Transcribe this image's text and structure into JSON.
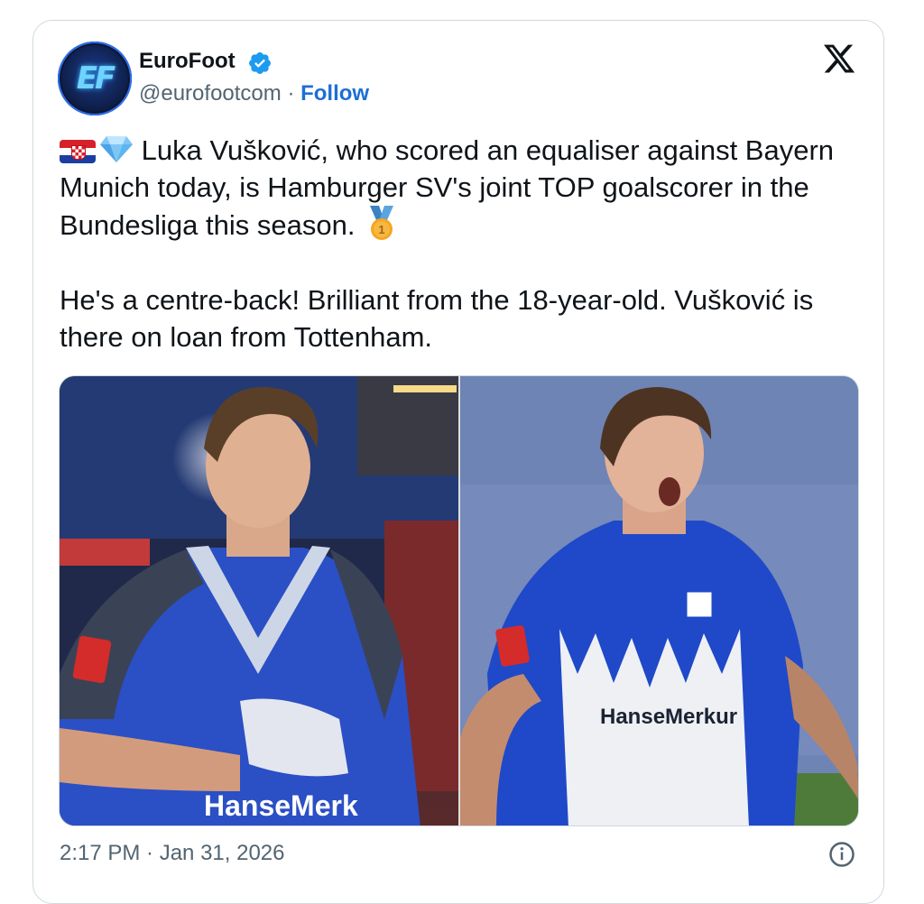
{
  "author": {
    "name": "EuroFoot",
    "handle": "@eurofootcom",
    "separator": " · ",
    "follow_label": "Follow",
    "avatar_logo_text": "EF"
  },
  "icons": {
    "verified": "verified-badge-icon",
    "x_logo": "x-logo-icon",
    "flag": "croatia-flag-icon",
    "gem": "gem-stone-icon",
    "medal": "first-place-medal-icon",
    "info": "info-icon"
  },
  "tweet": {
    "para1": "Luka Vušković, who scored an equaliser against Bayern Munich today, is Hamburger SV's joint TOP goalscorer in the Bundesliga this season.",
    "para2": "He's a centre-back! Brilliant from the 18-year-old. Vušković is there on loan from Tottenham."
  },
  "media": {
    "photo1_jersey_text": "HanseMerk",
    "photo2_jersey_text": "HanseMerkur"
  },
  "timestamp": "2:17 PM · Jan 31, 2026",
  "colors": {
    "accent": "#1d6fd6",
    "verified": "#1d9bf0",
    "secondary_text": "#536471",
    "border": "#cfd9de"
  }
}
